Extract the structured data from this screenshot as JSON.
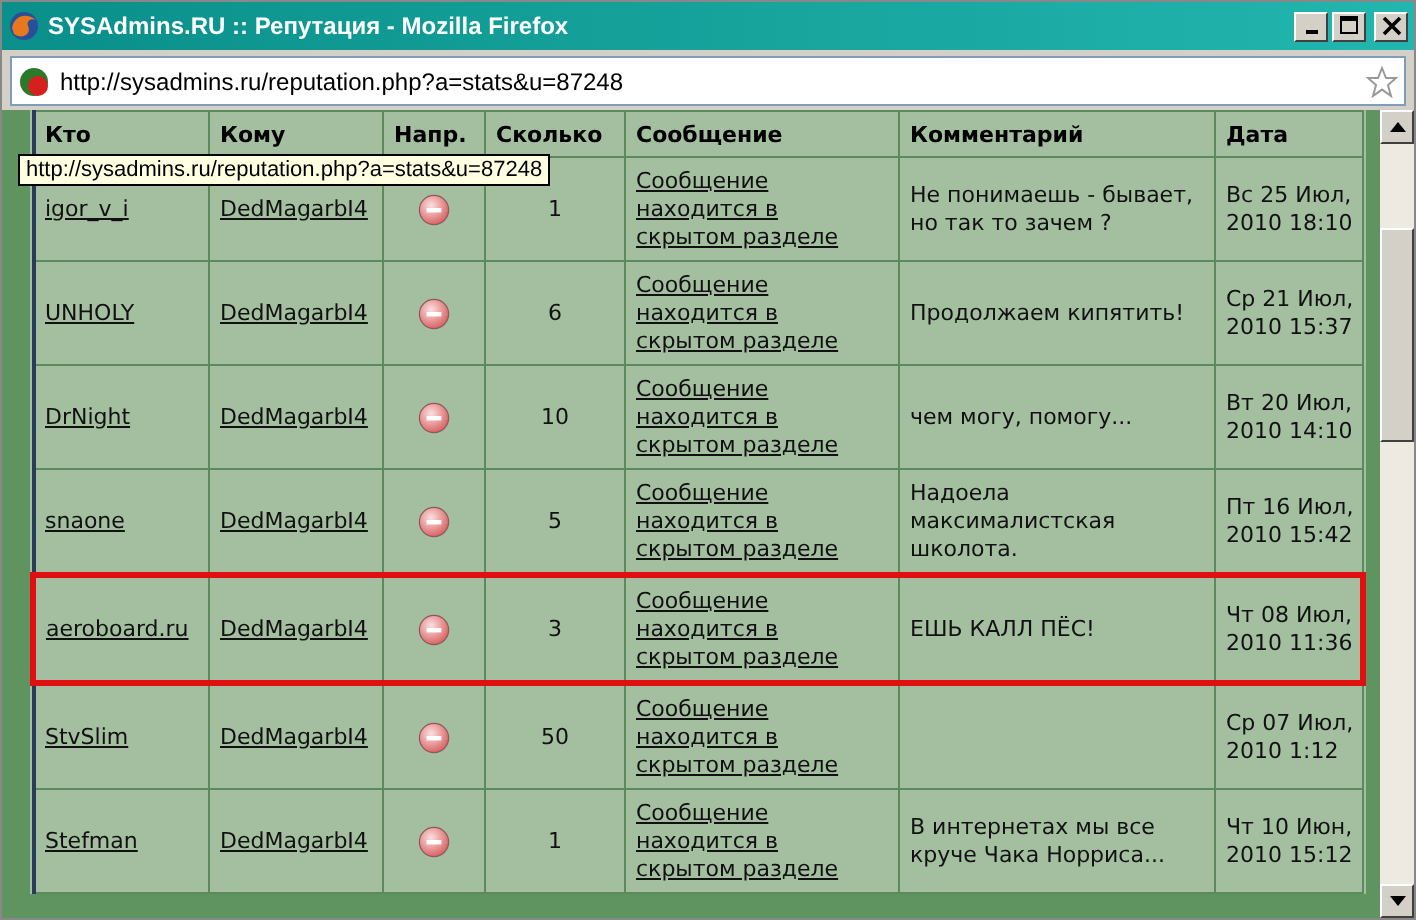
{
  "window": {
    "title": "SYSAdmins.RU :: Репутация - Mozilla Firefox"
  },
  "address_bar": {
    "value": "http://sysadmins.ru/reputation.php?a=stats&u=87248"
  },
  "tooltip": "http://sysadmins.ru/reputation.php?a=stats&u=87248",
  "table": {
    "columns": [
      "Кто",
      "Кому",
      "Напр.",
      "Сколько",
      "Сообщение",
      "Комментарий",
      "Дата"
    ],
    "rows": [
      {
        "from": "igor_v_i",
        "to": "DedMagarbI4",
        "negative": true,
        "amount": "1",
        "message": "Сообщение находится в скрытом разделе",
        "comment": "Не понимаешь - бывает, но так то зачем ?",
        "date": "Вс 25 Июл, 2010 18:10",
        "highlighted": false
      },
      {
        "from": "UNHOLY",
        "to": "DedMagarbI4",
        "negative": true,
        "amount": "6",
        "message": "Сообщение находится в скрытом разделе",
        "comment": "Продолжаем кипятить!",
        "date": "Ср 21 Июл, 2010 15:37",
        "highlighted": false
      },
      {
        "from": "DrNight",
        "to": "DedMagarbI4",
        "negative": true,
        "amount": "10",
        "message": "Сообщение находится в скрытом разделе",
        "comment": "чем могу, помогу...",
        "date": "Вт 20 Июл, 2010 14:10",
        "highlighted": false
      },
      {
        "from": "snaone",
        "to": "DedMagarbI4",
        "negative": true,
        "amount": "5",
        "message": "Сообщение находится в скрытом разделе",
        "comment": "Надоела максималистская школота.",
        "date": "Пт 16 Июл, 2010 15:42",
        "highlighted": false
      },
      {
        "from": "aeroboard.ru",
        "to": "DedMagarbI4",
        "negative": true,
        "amount": "3",
        "message": "Сообщение находится в скрытом разделе",
        "comment": "ЕШЬ КАЛЛ ПЁС!",
        "date": "Чт 08 Июл, 2010 11:36",
        "highlighted": true
      },
      {
        "from": "StvSlim",
        "to": "DedMagarbI4",
        "negative": true,
        "amount": "50",
        "message": "Сообщение находится в скрытом разделе",
        "date": "Ср 07 Июл, 2010 1:12",
        "highlighted": false
      },
      {
        "from": "Stefman",
        "to": "DedMagarbI4",
        "negative": true,
        "amount": "1",
        "message": "Сообщение находится в скрытом разделе",
        "comment": "В интернетах мы все круче Чака Норриса...",
        "date": "Чт 10 Июн, 2010 15:12",
        "highlighted": false
      }
    ]
  }
}
